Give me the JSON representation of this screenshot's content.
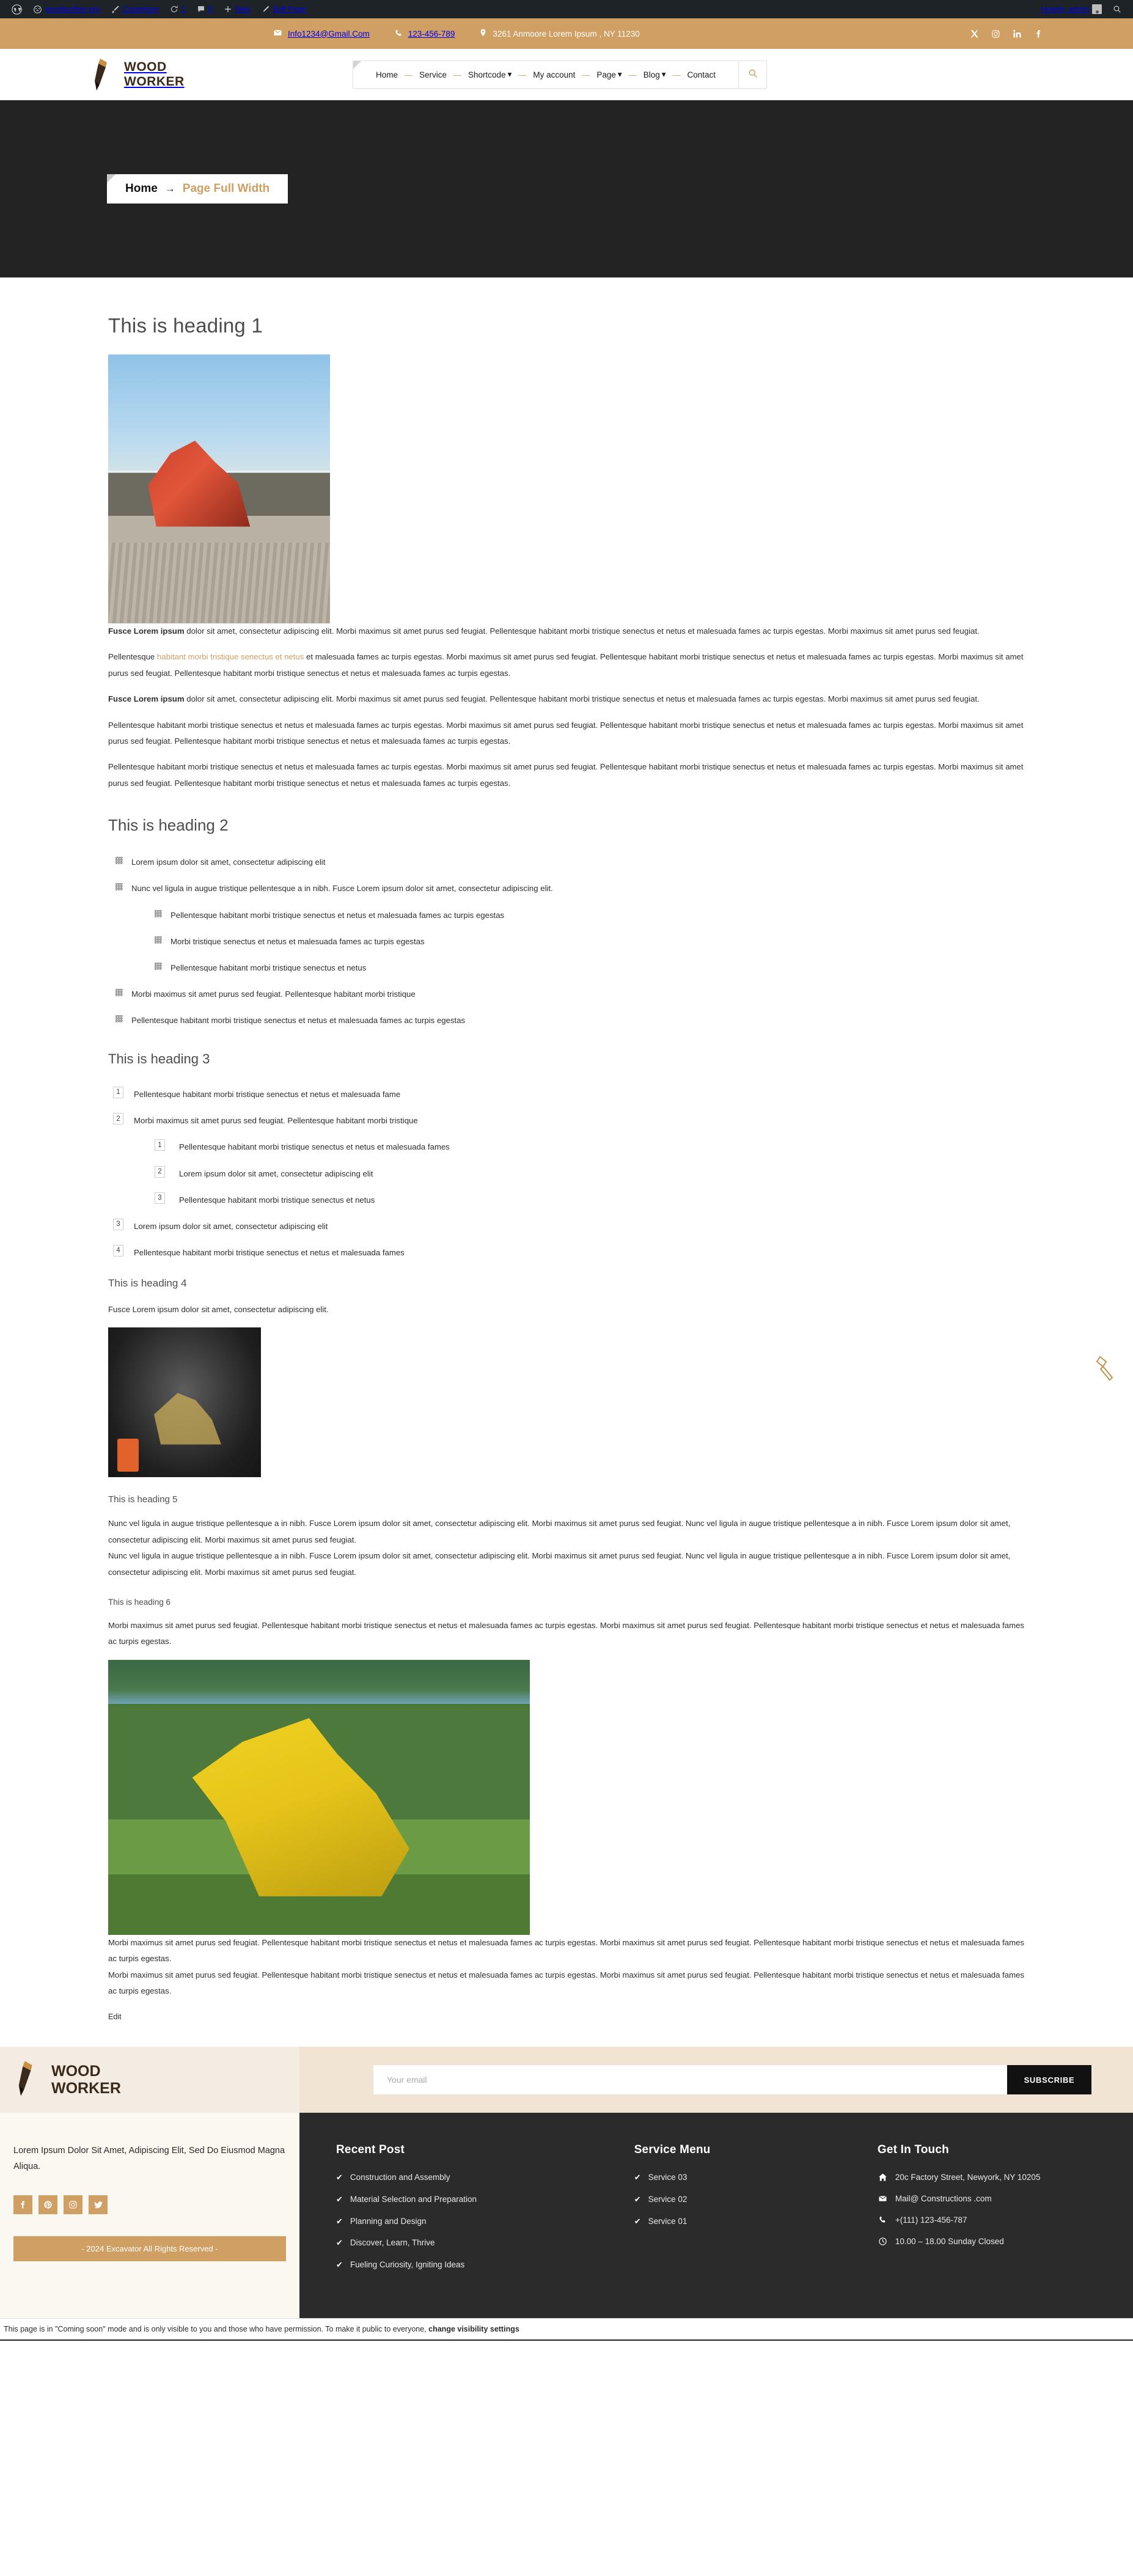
{
  "adminbar": {
    "site_name": "woodworker-pro",
    "customize": "Customize",
    "updates_count": "1",
    "comments_count": "0",
    "new": "New",
    "edit_page": "Edit Page",
    "howdy": "Howdy, admin",
    "icons": [
      "wordpress-icon",
      "dashboard-icon",
      "brush-icon",
      "updates-icon",
      "comment-icon",
      "plus-icon",
      "pencil-icon",
      "avatar",
      "search-icon"
    ]
  },
  "topbar": {
    "email": "Info1234@Gmail.Com",
    "phone": "123-456-789",
    "address": "3261 Anmoore Lorem Ipsum , NY 11230",
    "socials": [
      "x-twitter-icon",
      "instagram-icon",
      "linkedin-icon",
      "facebook-icon"
    ],
    "bg": "#cf9f63"
  },
  "header": {
    "logo_line1": "Wood",
    "logo_line2": "Worker",
    "nav": [
      {
        "label": "Home",
        "caret": false
      },
      {
        "label": "Service",
        "caret": false
      },
      {
        "label": "Shortcode",
        "caret": true
      },
      {
        "label": "My account",
        "caret": false
      },
      {
        "label": "Page",
        "caret": true
      },
      {
        "label": "Blog",
        "caret": true
      },
      {
        "label": "Contact",
        "caret": false
      }
    ],
    "separator": "—",
    "search_icon": "search-icon"
  },
  "hero": {
    "home_label": "Home",
    "arrow": "→",
    "current": "Page Full Width",
    "bg": "#232323"
  },
  "content": {
    "h1": "This is heading 1",
    "p1_bold": "Fusce Lorem ipsum",
    "p1_rest": " dolor sit amet, consectetur adipiscing elit. Morbi maximus sit amet purus sed feugiat. Pellentesque habitant morbi tristique senectus et netus et malesuada fames ac turpis egestas. Morbi maximus sit amet purus sed feugiat.",
    "p2_lead": "Pellentesque ",
    "p2_link": "habitant morbi tristique senectus et netus",
    "p2_rest": " et malesuada fames ac turpis egestas. Morbi maximus sit amet purus sed feugiat. Pellentesque habitant morbi tristique senectus et netus et malesuada fames ac turpis egestas. Morbi maximus sit amet purus sed feugiat. Pellentesque habitant morbi tristique senectus et netus et malesuada fames ac turpis egestas.",
    "p3_bold": "Fusce Lorem ipsum",
    "p3_rest": " dolor sit amet, consectetur adipiscing elit. Morbi maximus sit amet purus sed feugiat. Pellentesque habitant morbi tristique senectus et netus et malesuada fames ac turpis egestas. Morbi maximus sit amet purus sed feugiat.",
    "p4": "Pellentesque habitant morbi tristique senectus et netus et malesuada fames ac turpis egestas. Morbi maximus sit amet purus sed feugiat. Pellentesque habitant morbi tristique senectus et netus et malesuada fames ac turpis egestas. Morbi maximus sit amet purus sed feugiat. Pellentesque habitant morbi tristique senectus et netus et malesuada fames ac turpis egestas.",
    "p5": "Pellentesque habitant morbi tristique senectus et netus et malesuada fames ac turpis egestas. Morbi maximus sit amet purus sed feugiat. Pellentesque habitant morbi tristique senectus et netus et malesuada fames ac turpis egestas. Morbi maximus sit amet purus sed feugiat. Pellentesque habitant morbi tristique senectus et netus et malesuada fames ac turpis egestas.",
    "h2": "This is heading 2",
    "ul": [
      "Lorem ipsum dolor sit amet, consectetur adipiscing elit",
      "Nunc vel ligula in augue tristique pellentesque a in nibh. Fusce Lorem ipsum dolor sit amet, consectetur adipiscing elit.",
      "Morbi maximus sit amet purus sed feugiat. Pellentesque habitant morbi tristique",
      "Pellentesque habitant morbi tristique senectus et netus et malesuada fames ac turpis egestas"
    ],
    "ul_nested": [
      "Pellentesque habitant morbi tristique senectus et netus et malesuada fames ac turpis egestas",
      "Morbi tristique senectus et netus et malesuada fames ac turpis egestas",
      "Pellentesque habitant morbi tristique senectus et netus"
    ],
    "h3": "This is heading 3",
    "ol": [
      {
        "num": "1",
        "text": "Pellentesque habitant morbi tristique senectus et netus et malesuada fame"
      },
      {
        "num": "2",
        "text": "Morbi maximus sit amet purus sed feugiat. Pellentesque habitant morbi tristique"
      },
      {
        "num": "3",
        "text": "Lorem ipsum dolor sit amet, consectetur adipiscing elit"
      },
      {
        "num": "4",
        "text": "Pellentesque habitant morbi tristique senectus et netus et malesuada fames"
      }
    ],
    "ol_nested": [
      {
        "num": "1",
        "text": "Pellentesque habitant morbi tristique senectus et netus et malesuada fames"
      },
      {
        "num": "2",
        "text": "Lorem ipsum dolor sit amet, consectetur adipiscing elit"
      },
      {
        "num": "3",
        "text": "Pellentesque habitant morbi tristique senectus et netus"
      }
    ],
    "h4": "This is heading 4",
    "h4_p": "Fusce Lorem ipsum dolor sit amet, consectetur adipiscing elit.",
    "h5": "This is heading 5",
    "h5_p1": "Nunc vel ligula in augue tristique pellentesque a in nibh. Fusce Lorem ipsum dolor sit amet, consectetur adipiscing elit. Morbi maximus sit amet purus sed feugiat. Nunc vel ligula in augue tristique pellentesque a in nibh. Fusce Lorem ipsum dolor sit amet, consectetur adipiscing elit. Morbi maximus sit amet purus sed feugiat.",
    "h5_p2": "Nunc vel ligula in augue tristique pellentesque a in nibh. Fusce Lorem ipsum dolor sit amet, consectetur adipiscing elit. Morbi maximus sit amet purus sed feugiat. Nunc vel ligula in augue tristique pellentesque a in nibh. Fusce Lorem ipsum dolor sit amet, consectetur adipiscing elit. Morbi maximus sit amet purus sed feugiat.",
    "h6": "This is heading 6",
    "h6_p": "Morbi maximus sit amet purus sed feugiat. Pellentesque habitant morbi tristique senectus et netus et malesuada fames ac turpis egestas. Morbi maximus sit amet purus sed feugiat. Pellentesque habitant morbi tristique senectus et netus et malesuada fames ac turpis egestas.",
    "last_p1": "Morbi maximus sit amet purus sed feugiat. Pellentesque habitant morbi tristique senectus et netus et malesuada fames ac turpis egestas. Morbi maximus sit amet purus sed feugiat. Pellentesque habitant morbi tristique senectus et netus et malesuada fames ac turpis egestas.",
    "last_p2": "Morbi maximus sit amet purus sed feugiat. Pellentesque habitant morbi tristique senectus et netus et malesuada fames ac turpis egestas. Morbi maximus sit amet purus sed feugiat. Pellentesque habitant morbi tristique senectus et netus et malesuada fames ac turpis egestas.",
    "edit": "Edit",
    "images": [
      "excavator-red-roadwork-photo",
      "tunnel-machinery-photo",
      "yellow-excavator-field-photo"
    ],
    "float_widget": "saw-icon"
  },
  "newsletter": {
    "logo_line1": "Wood",
    "logo_line2": "Worker",
    "email_placeholder": "Your email",
    "email_value": "",
    "subscribe_label": "SUBSCRIBE"
  },
  "footer": {
    "tagline": "Lorem Ipsum Dolor Sit Amet, Adipiscing Elit, Sed Do Eiusmod Magna Aliqua.",
    "socials": [
      "facebook-icon",
      "pinterest-icon",
      "instagram-icon",
      "twitter-icon"
    ],
    "copyright": "- 2024 Excavator All Rights Reserved -",
    "columns": [
      {
        "title": "Recent Post",
        "items": [
          "Construction and Assembly",
          "Material Selection and Preparation",
          "Planning and Design",
          "Discover, Learn, Thrive",
          "Fueling Curiosity, Igniting Ideas"
        ]
      },
      {
        "title": "Service Menu",
        "items": [
          "Service 03",
          "Service 02",
          "Service 01"
        ]
      }
    ],
    "contact": {
      "title": "Get In Touch",
      "items": [
        {
          "icon": "home-icon",
          "text": "20c Factory Street, Newyork, NY 10205"
        },
        {
          "icon": "mail-icon",
          "text": "Mail@ Constructions .com"
        },
        {
          "icon": "phone-icon",
          "text": "+(111) 123-456-787"
        },
        {
          "icon": "clock-icon",
          "text": "10.00 – 18.00 Sunday Closed"
        }
      ]
    }
  },
  "comingsoon": {
    "text": "This page is in \"Coming soon\" mode and is only visible to you and those who have permission. To make it public to everyone, ",
    "link": "change visibility settings"
  }
}
